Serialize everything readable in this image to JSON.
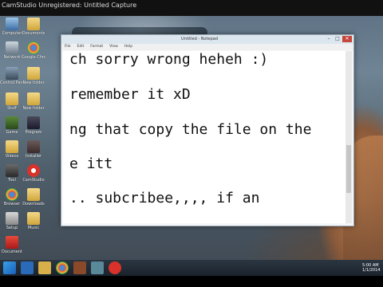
{
  "recorder": {
    "title": "CamStudio Unregistered: Untitled Capture"
  },
  "desktop": {
    "icons": [
      {
        "name": "recycle-bin-icon",
        "label": "Computer"
      },
      {
        "name": "folder-icon",
        "label": "Documents"
      },
      {
        "name": "network-icon",
        "label": "Network"
      },
      {
        "name": "chrome-icon",
        "label": "Google Chrome"
      },
      {
        "name": "control-panel-icon",
        "label": "Control Panel"
      },
      {
        "name": "folder-icon-2",
        "label": "New folder"
      },
      {
        "name": "folder-icon-3",
        "label": "Stuff"
      },
      {
        "name": "folder-icon-4",
        "label": "New folder"
      },
      {
        "name": "game-icon",
        "label": "Game"
      },
      {
        "name": "app-icon",
        "label": "Program"
      },
      {
        "name": "folder-icon-5",
        "label": "Videos"
      },
      {
        "name": "app-icon-2",
        "label": "Installer"
      },
      {
        "name": "app-icon-3",
        "label": "Tool"
      },
      {
        "name": "app-icon-4",
        "label": "CamStudio"
      },
      {
        "name": "chrome-icon-2",
        "label": "Browser"
      },
      {
        "name": "folder-icon-6",
        "label": "Downloads"
      },
      {
        "name": "app-icon-5",
        "label": "Setup"
      },
      {
        "name": "folder-icon-7",
        "label": "Music"
      },
      {
        "name": "pdf-icon",
        "label": "Document"
      }
    ]
  },
  "notepad": {
    "title": "Untitled - Notepad",
    "menu": [
      "File",
      "Edit",
      "Format",
      "View",
      "Help"
    ],
    "lines": [
      "ch sorry wrong heheh :)",
      " remember it xD",
      "ng that copy the file on the",
      "e itt",
      ".. subcribee,,,, if an"
    ]
  },
  "taskbar": {
    "time": "5:00 AM",
    "date": "1/1/2014"
  },
  "colors": {
    "accent": "#c7463b",
    "taskbar": "#1b232c"
  }
}
